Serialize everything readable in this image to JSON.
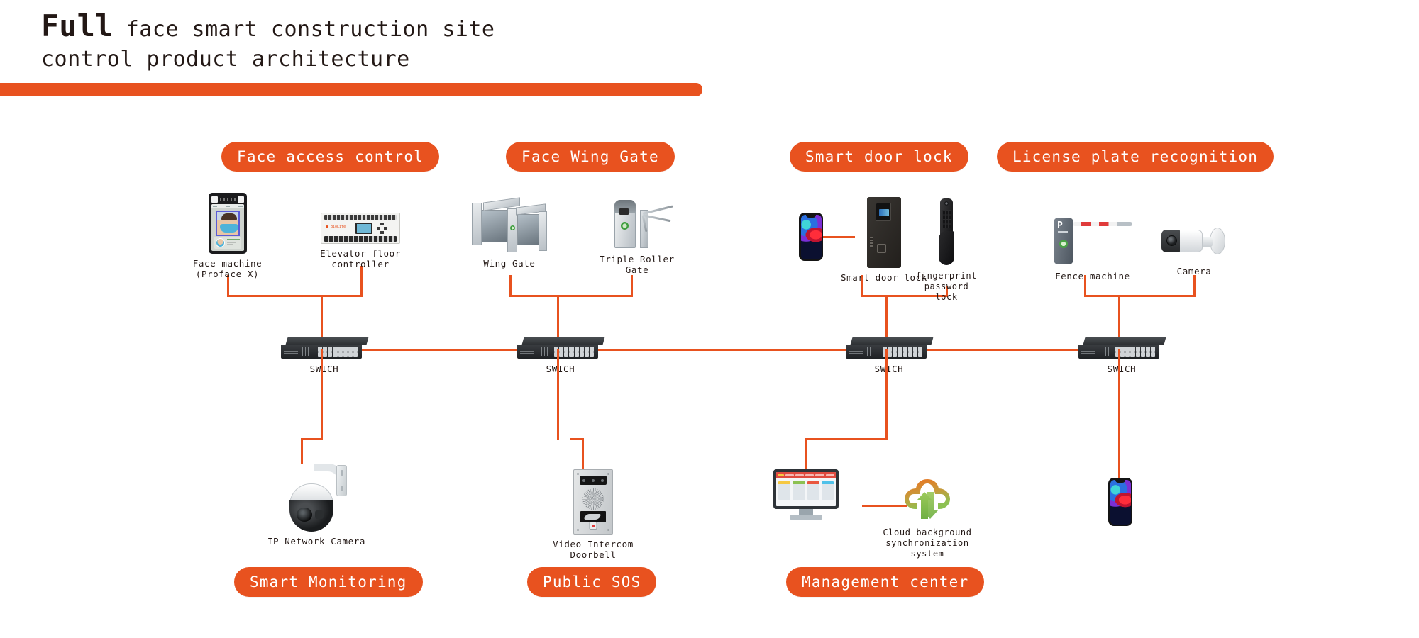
{
  "header": {
    "title_lead": "Full",
    "title_rest": " face smart construction site",
    "title_line2": "control product architecture"
  },
  "colors": {
    "accent": "#E8521F",
    "text": "#231815",
    "background": "#FFFFFF"
  },
  "top_groups": [
    {
      "pill": "Face access control"
    },
    {
      "pill": "Face Wing Gate"
    },
    {
      "pill": "Smart door lock"
    },
    {
      "pill": "License plate recognition"
    }
  ],
  "bottom_groups": [
    {
      "pill": "Smart Monitoring"
    },
    {
      "pill": "Public SOS"
    },
    {
      "pill": "Management center"
    }
  ],
  "devices": {
    "face_machine": "Face machine\n(Proface X)",
    "elevator_controller": "Elevator floor controller",
    "wing_gate": "Wing Gate",
    "triple_roller_gate": "Triple Roller Gate",
    "smart_door_lock": "Smart door lock",
    "fingerprint_lock": "fingerprint\npassword lock",
    "fence_machine": "Fence machine",
    "camera": "Camera",
    "ip_network_camera": "IP Network Camera",
    "video_intercom_doorbell": "Video Intercom Doorbell",
    "cloud_sync": "Cloud background\nsynchronization system"
  },
  "switches": [
    {
      "label": "SWICH"
    },
    {
      "label": "SWICH"
    },
    {
      "label": "SWICH"
    },
    {
      "label": "SWICH"
    }
  ]
}
